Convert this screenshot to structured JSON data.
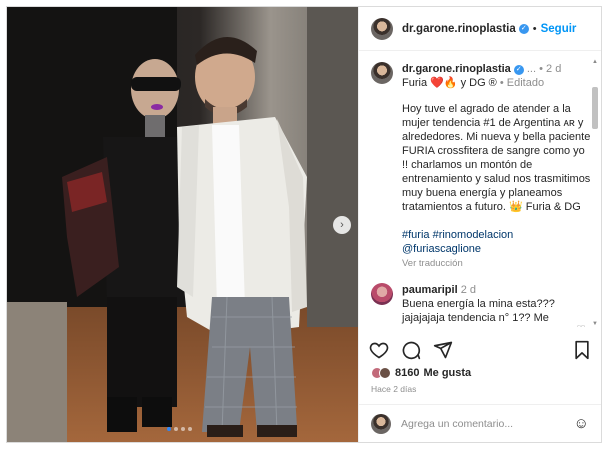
{
  "post": {
    "username": "dr.garone.rinoplastia",
    "follow_label": "Seguir",
    "verified_mark": "✓",
    "separator": "•",
    "more_dots": "...",
    "caption_time": "2 d",
    "collab_line": "Furia ❤️🔥 y DG ®",
    "edited_label": "Editado",
    "body": "Hoy tuve el agrado de atender a la mujer tendencia #1 de Argentina ᴀʀ y alrededores. Mi nueva y bella paciente FURIA crossfitera de sangre como yo !! charlamos un montón de entrenamiento y salud nos trasmitimos muy buena energía y planeamos tratamientos a futuro. 👑 Furia & DG",
    "hashtags": "#furia #rinomodelacion",
    "mention": "@furiascaglione",
    "see_translation": "Ver traducción"
  },
  "comment": {
    "username": "paumaripil",
    "time": "2 d",
    "text": "Buena energía la mina esta??? jajajajaja tendencia n° 1?? Me parece que el canje fue al revés"
  },
  "actions": {
    "likes_count": "8160",
    "likes_label": "Me gusta",
    "posted_ago": "Hace 2 días"
  },
  "add_comment": {
    "placeholder": "Agrega un comentario..."
  },
  "icons": {
    "like": "heart-icon",
    "comment": "comment-icon",
    "share": "paper-plane-icon",
    "save": "bookmark-icon",
    "emoji": "emoji-icon",
    "next": "chevron-right-icon"
  },
  "colors": {
    "accent": "#0095f6",
    "verified": "#3897f0",
    "muted": "#8e8e8e",
    "carousel_active": "#2f86f6"
  },
  "carousel": {
    "slide_count": 4,
    "active_index": 0
  }
}
